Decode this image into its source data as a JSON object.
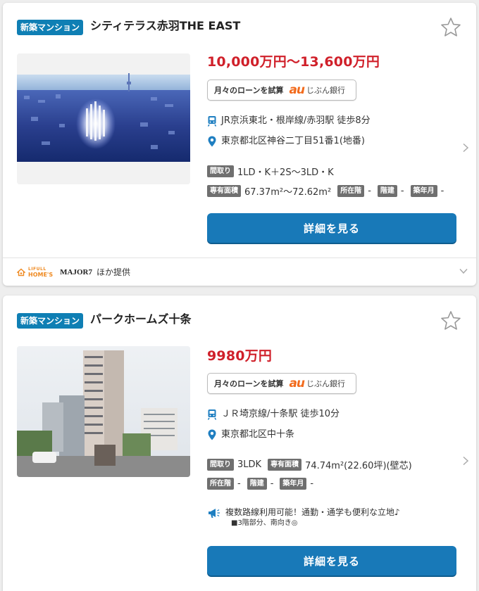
{
  "listings": [
    {
      "badge": "新築マンション",
      "title": "シティテラス赤羽THE EAST",
      "price": "10,000万円～13,600万円",
      "loan": {
        "label": "月々のローンを試算",
        "brand": "au",
        "bank": "じぶん銀行"
      },
      "station": "JR京浜東北・根岸線/赤羽駅 徒歩8分",
      "address": "東京都北区神谷二丁目51番1(地番)",
      "specs": {
        "madori_tag": "間取り",
        "madori": "1LD・K＋2S～3LD・K",
        "area_tag": "専有面積",
        "area": "67.37m²～72.62m²",
        "location_tag": "所在階",
        "location": "-",
        "floors_tag": "階建",
        "floors": "-",
        "age_tag": "築年月",
        "age": "-"
      },
      "detail_button": "詳細を見る",
      "providers": {
        "lifull_top": "LIFULL",
        "lifull_bottom": "HOME'S",
        "major": "MAJOR7",
        "suffix": "ほか提供"
      }
    },
    {
      "badge": "新築マンション",
      "title": "パークホームズ十条",
      "price": "9980万円",
      "loan": {
        "label": "月々のローンを試算",
        "brand": "au",
        "bank": "じぶん銀行"
      },
      "station": "ＪＲ埼京線/十条駅 徒歩10分",
      "address": "東京都北区中十条",
      "specs": {
        "madori_tag": "間取り",
        "madori": "3LDK",
        "area_tag": "専有面積",
        "area": "74.74m²(22.60坪)(壁芯)",
        "location_tag": "所在階",
        "location": "-",
        "floors_tag": "階建",
        "floors": "-",
        "age_tag": "築年月",
        "age": "-"
      },
      "promo": {
        "main": "複数路線利用可能！通勤・通学も便利な立地♪",
        "sub": "■3階部分、南向き◎"
      },
      "detail_button": "詳細を見る"
    }
  ],
  "colors": {
    "badge": "#0f7fb4",
    "price": "#d0202a",
    "button": "#1879b8",
    "tag": "#6f6f6f",
    "icon": "#1f7fc1"
  }
}
